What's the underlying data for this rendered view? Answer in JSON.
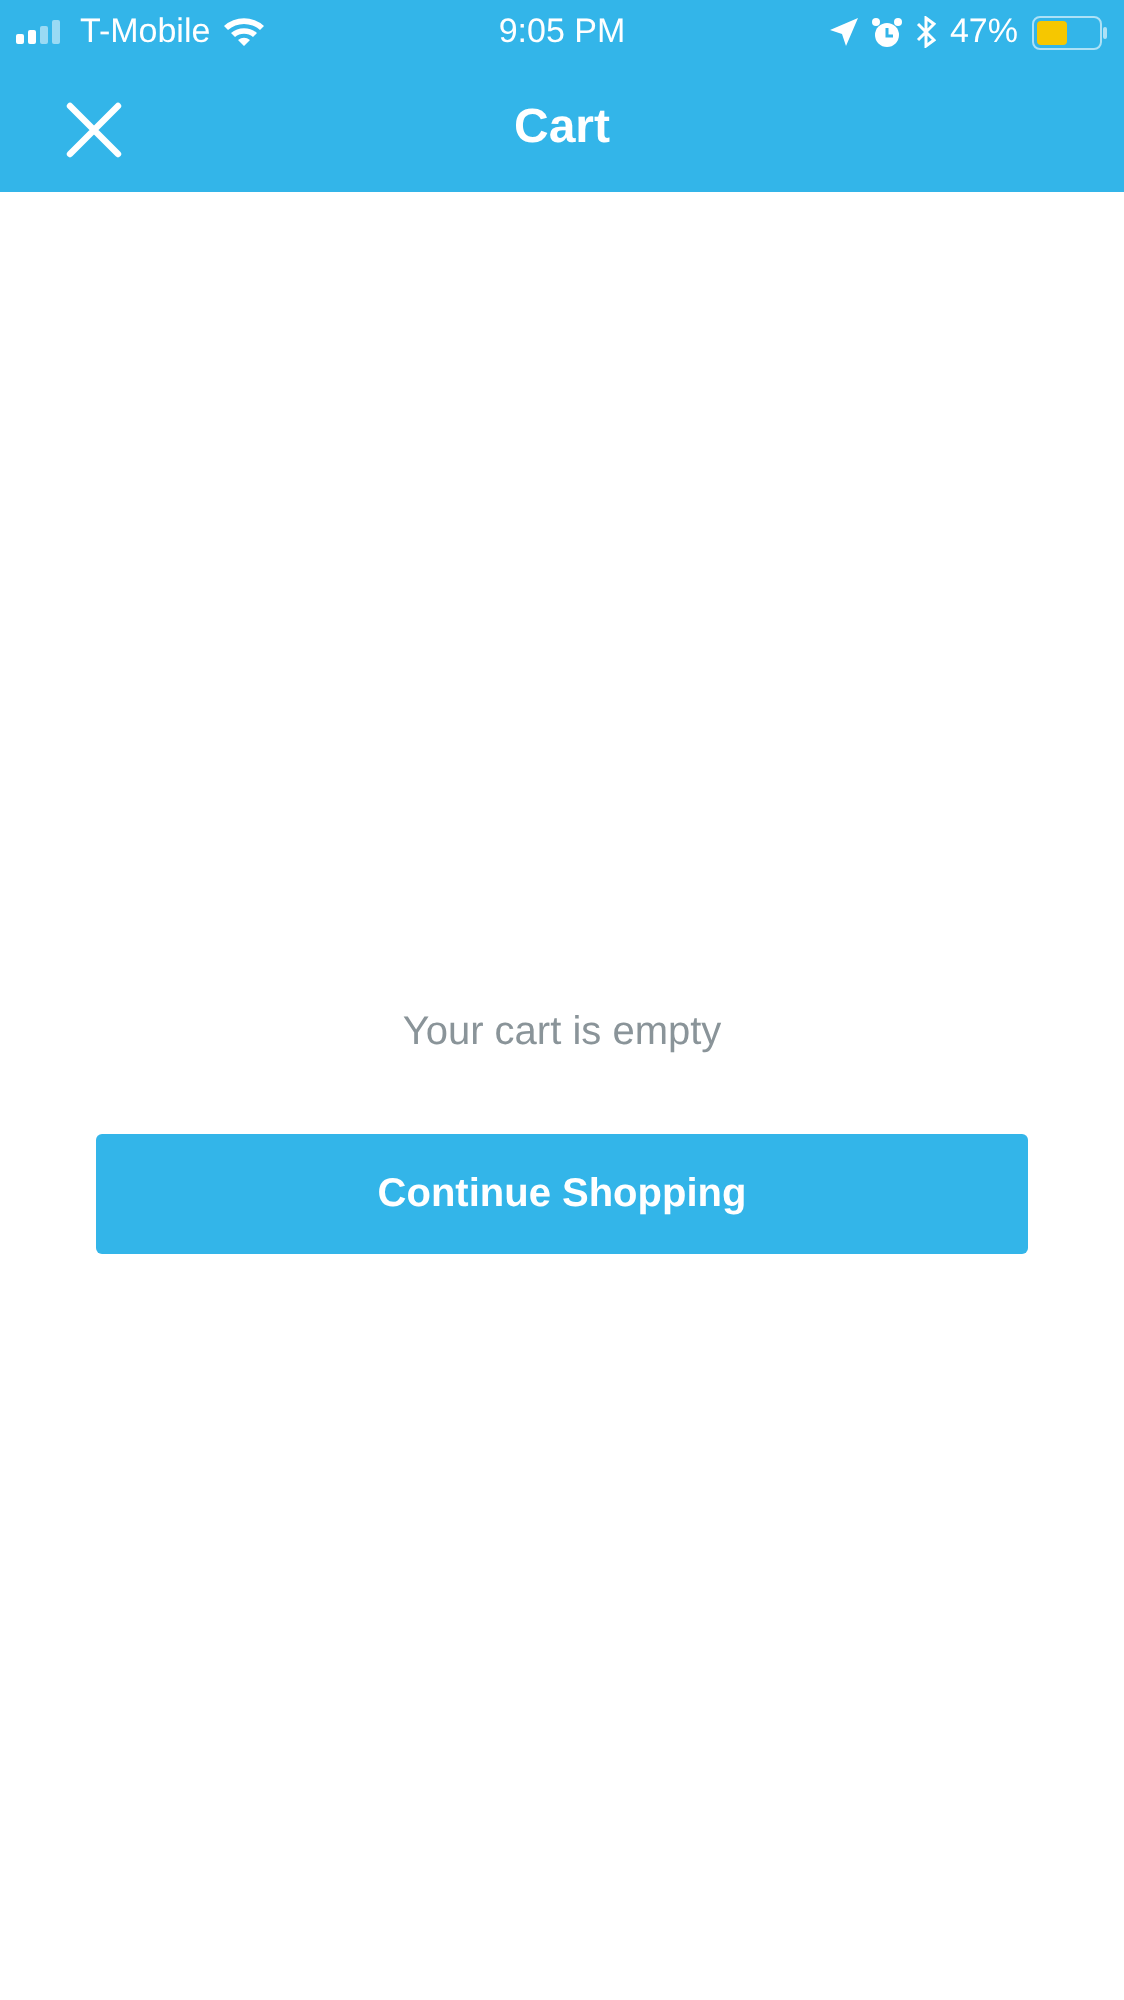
{
  "status_bar": {
    "carrier": "T-Mobile",
    "time": "9:05 PM",
    "battery": "47%"
  },
  "nav_bar": {
    "title": "Cart"
  },
  "empty_state": {
    "message": "Your cart is empty",
    "button": "Continue Shopping"
  }
}
